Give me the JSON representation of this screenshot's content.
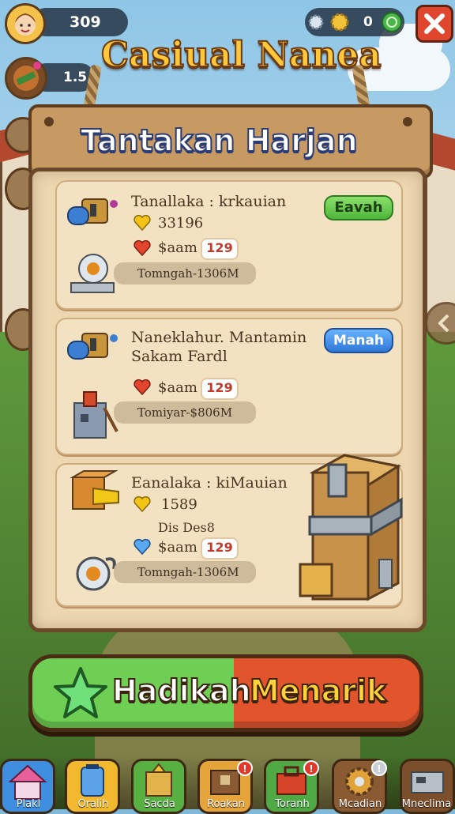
{
  "topbar": {
    "coins": "309",
    "level": "1.5",
    "currency_right": "0"
  },
  "title": "Casiual Nanea",
  "board": {
    "title": "Tantakan Harjan",
    "items": [
      {
        "name": "Tanallaka : krkauian",
        "gold": "33196",
        "hearts_label": "$aam",
        "hearts_value": "129",
        "bar": "Tomngah-1306M",
        "button": "Eavah"
      },
      {
        "name_line1": "Naneklahur. Mantamin",
        "name_line2": "Sakam Fardl",
        "hearts_label": "$aam",
        "hearts_value": "129",
        "bar": "Tomiyar-$806M",
        "button": "Manah"
      },
      {
        "name": "Eanalaka : kiMauian",
        "gold": "1589",
        "note": "Dis Des8",
        "hearts_label": "$aam",
        "hearts_value": "129",
        "bar": "Tomngah-1306M"
      }
    ]
  },
  "cta": {
    "part1": "Hadikah",
    "part2": "Menarik"
  },
  "nav": [
    {
      "label": "Plakl",
      "color": "#3f8fe0",
      "icon": "house-icon"
    },
    {
      "label": "Oralih",
      "color": "#f2b92f",
      "icon": "jar-icon"
    },
    {
      "label": "Sacda",
      "color": "#58b043",
      "icon": "crate-icon",
      "badge": ""
    },
    {
      "label": "Roakan",
      "color": "#e6a53a",
      "icon": "chest-icon",
      "badge": "!"
    },
    {
      "label": "Toranh",
      "color": "#4faa46",
      "icon": "toolbox-icon",
      "badge": "!"
    },
    {
      "label": "Mcadian",
      "color": "#8a5a32",
      "icon": "gear-icon",
      "badge": "!"
    },
    {
      "label": "Mneclima",
      "color": "#7b4f2c",
      "icon": "machine-icon"
    }
  ],
  "colors": {
    "accent_gold": "#ffc83a",
    "cta_green": "#6fcf55",
    "cta_orange": "#e2552c"
  }
}
